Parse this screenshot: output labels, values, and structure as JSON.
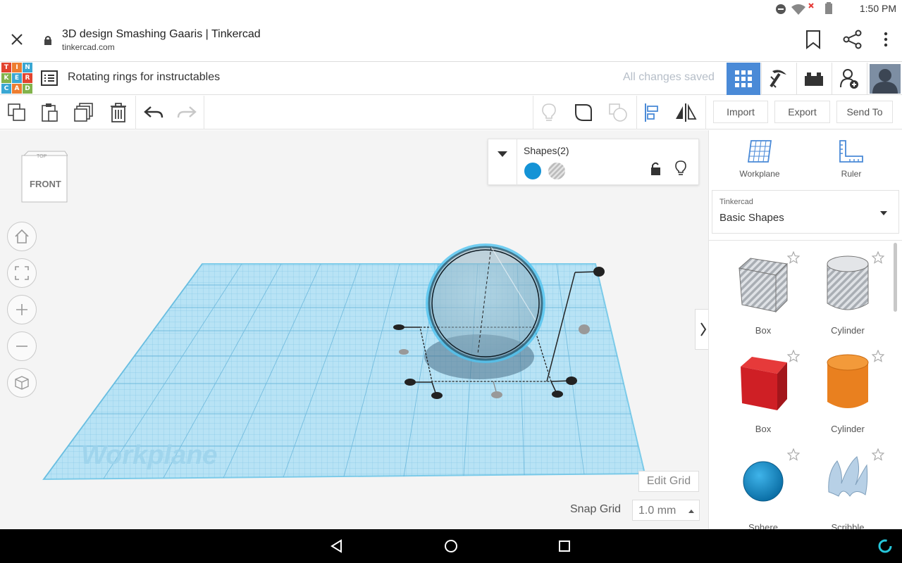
{
  "status": {
    "time": "1:50 PM"
  },
  "browser": {
    "page_title": "3D design Smashing Gaaris | Tinkercad",
    "url": "tinkercad.com"
  },
  "app": {
    "logo_letters": [
      "TIN",
      "KER",
      "CAD"
    ],
    "logo_colors": [
      "#e2442f",
      "#ed7d31",
      "#3aa7d3",
      "#82b34c",
      "#3aa7d3",
      "#e2442f",
      "#3aa7d3",
      "#ed7d31",
      "#82b34c"
    ],
    "design_title": "Rotating rings for instructables",
    "save_status": "All changes saved"
  },
  "toolbar": {
    "import_label": "Import",
    "export_label": "Export",
    "sendto_label": "Send To"
  },
  "viewcube": {
    "top_label": "TOP",
    "front_label": "FRONT"
  },
  "inspector": {
    "title": "Shapes(2)",
    "solid_color": "#1493d6"
  },
  "workplane_label": "Workplane",
  "edit_grid_label": "Edit Grid",
  "snap_grid": {
    "label": "Snap Grid",
    "value": "1.0 mm"
  },
  "right_panel": {
    "workplane_label": "Workplane",
    "ruler_label": "Ruler",
    "library_category": "Tinkercad",
    "library_name": "Basic Shapes",
    "shapes": [
      {
        "label": "Box",
        "style": "hole-box"
      },
      {
        "label": "Cylinder",
        "style": "hole-cylinder"
      },
      {
        "label": "Box",
        "style": "red-box"
      },
      {
        "label": "Cylinder",
        "style": "orange-cylinder"
      },
      {
        "label": "Sphere",
        "style": "blue-sphere"
      },
      {
        "label": "Scribble",
        "style": "scribble"
      }
    ]
  },
  "colors": {
    "accent_blue": "#4a8ad7",
    "workplane": "#8fd0ef"
  }
}
